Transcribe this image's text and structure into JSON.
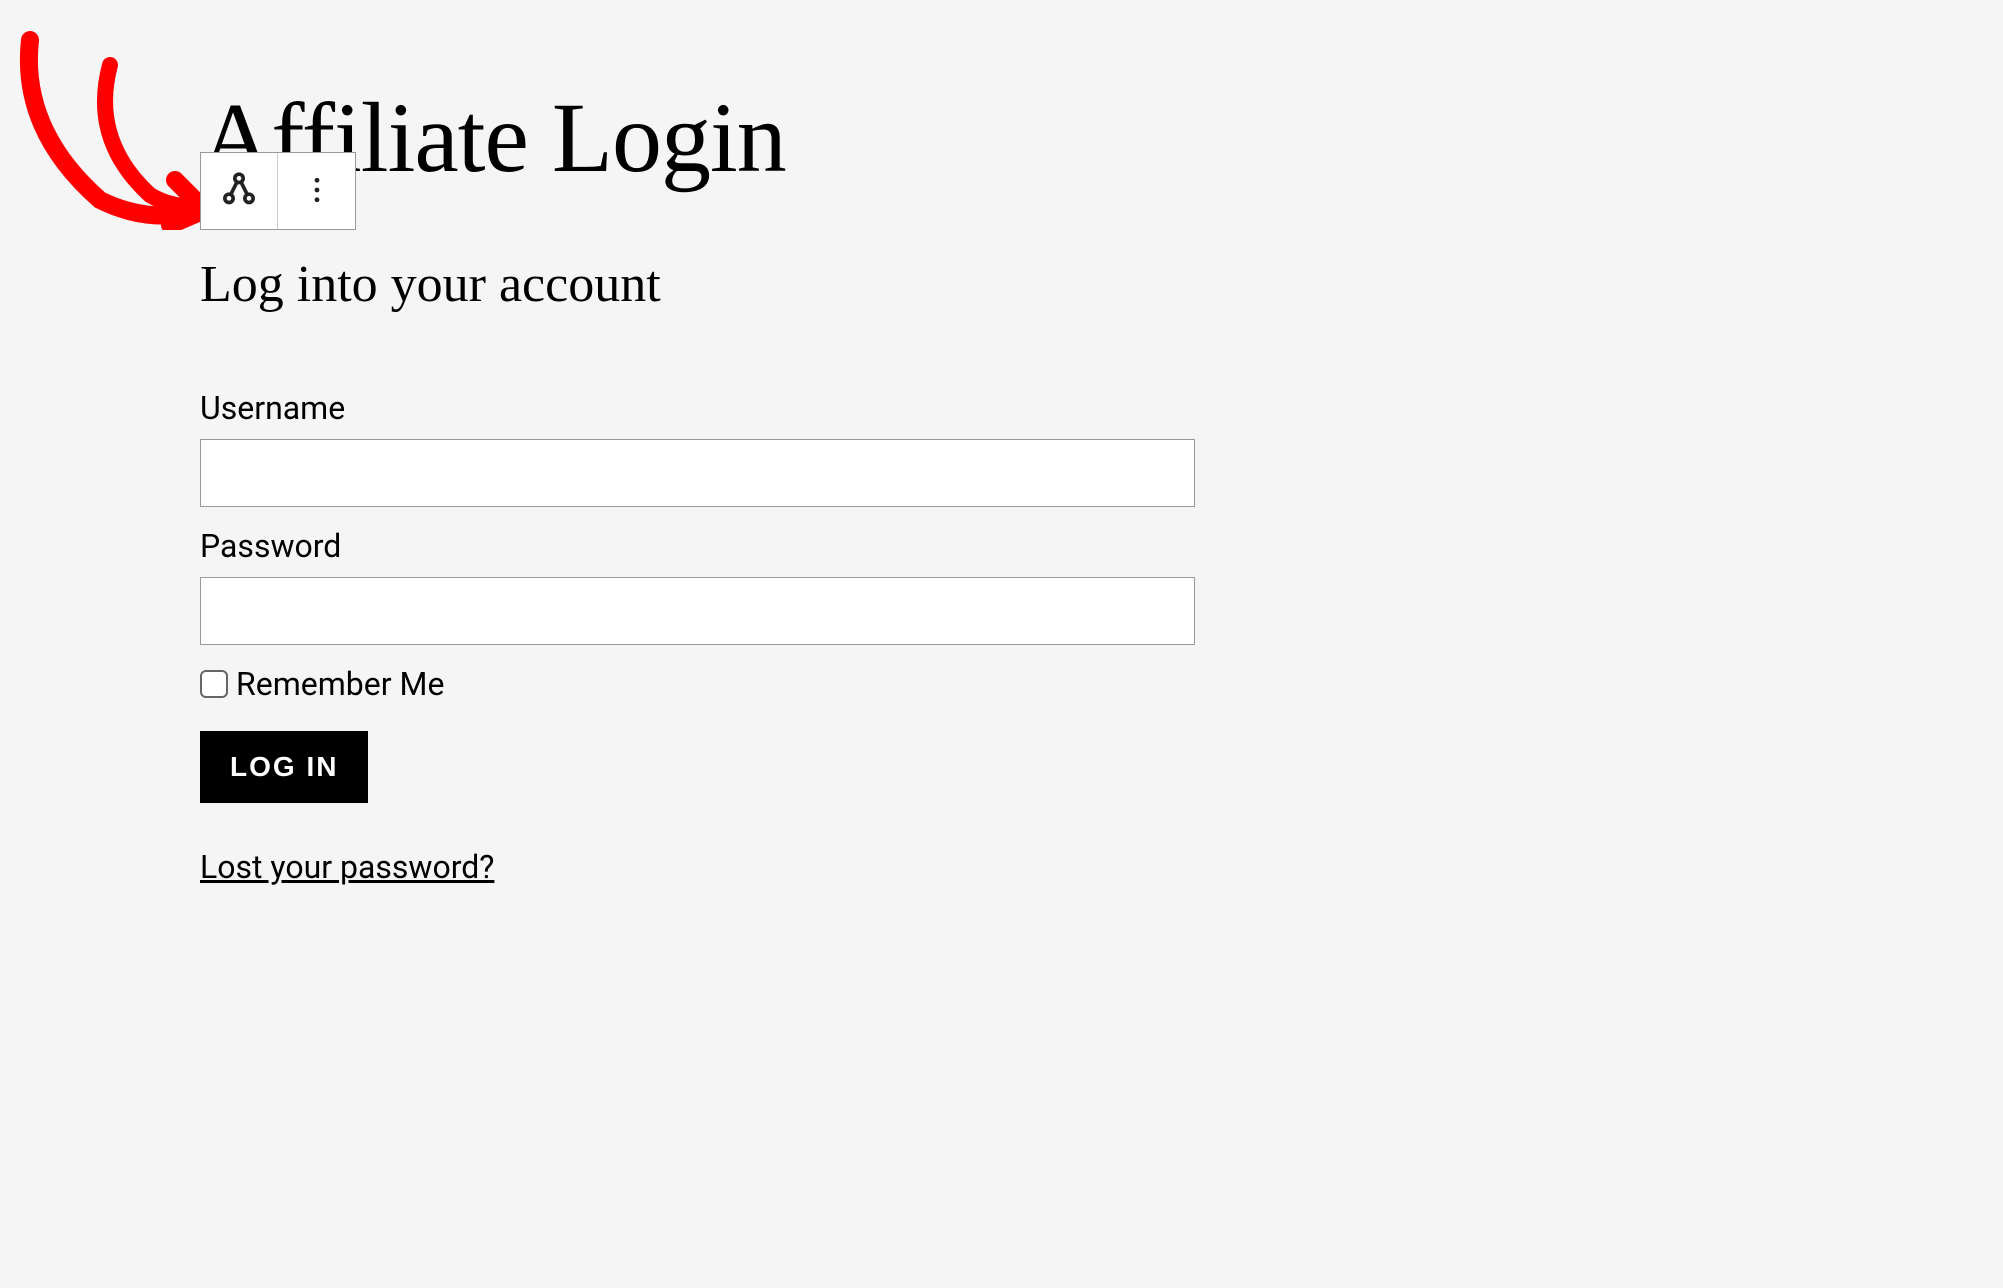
{
  "page": {
    "title": "Affiliate Login",
    "subtitle": "Log into your account"
  },
  "form": {
    "username_label": "Username",
    "username_value": "",
    "password_label": "Password",
    "password_value": "",
    "remember_label": "Remember Me",
    "submit_label": "LOG IN",
    "lost_password_label": "Lost your password?"
  },
  "toolbar": {
    "block_icon": "affiliate-block",
    "options_icon": "more-options"
  }
}
